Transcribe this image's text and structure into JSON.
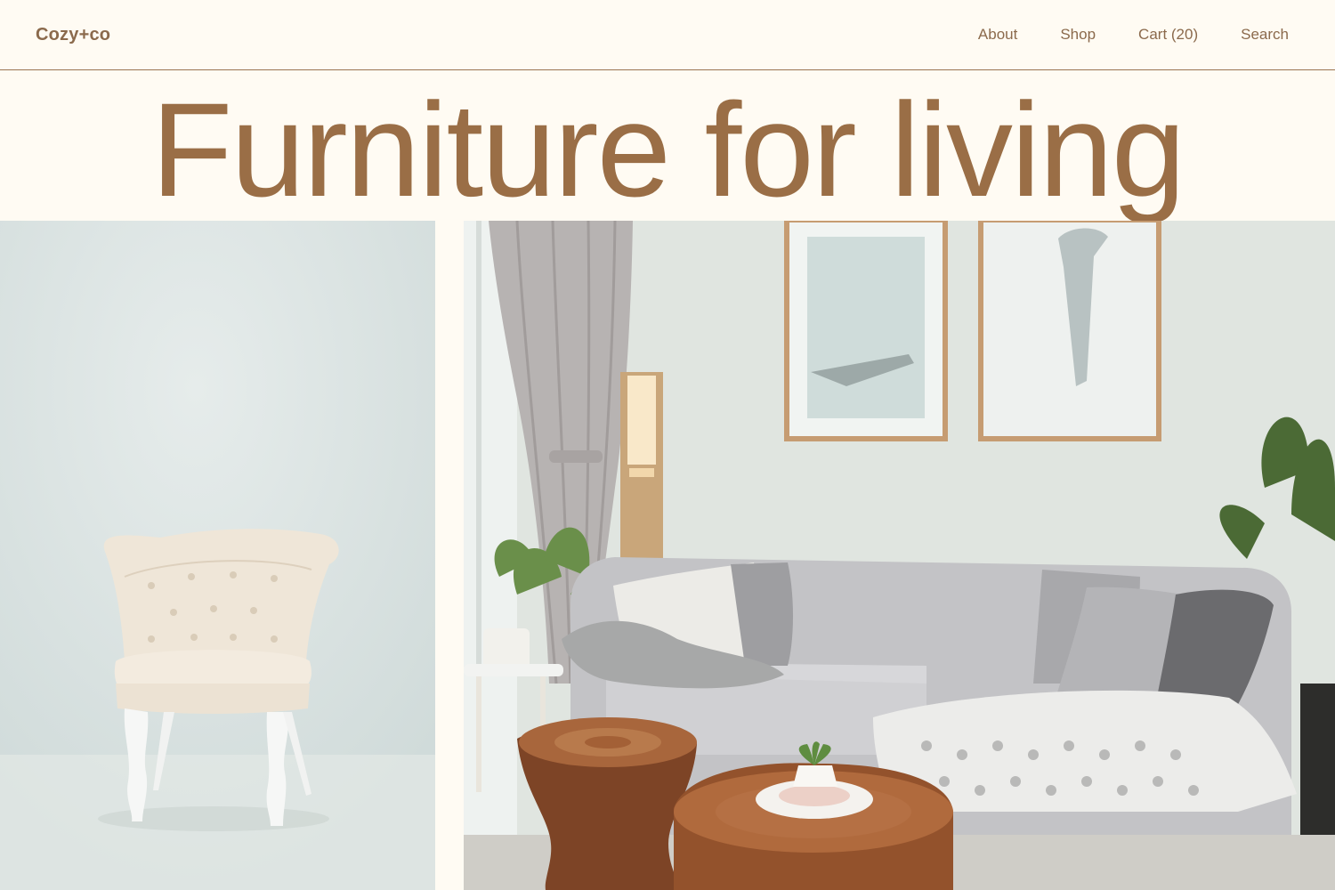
{
  "header": {
    "logo": "Cozy+co",
    "nav": [
      {
        "label": "About"
      },
      {
        "label": "Shop"
      },
      {
        "label": "Cart (20)"
      },
      {
        "label": "Search"
      }
    ]
  },
  "hero": {
    "title": "Furniture for living"
  },
  "photos": {
    "left": {
      "subject": "tufted-armchair-photo"
    },
    "right": {
      "subject": "living-room-photo"
    }
  },
  "colors": {
    "background": "#fffbf3",
    "accent": "#9a6e46",
    "text": "#8b6a4c"
  }
}
